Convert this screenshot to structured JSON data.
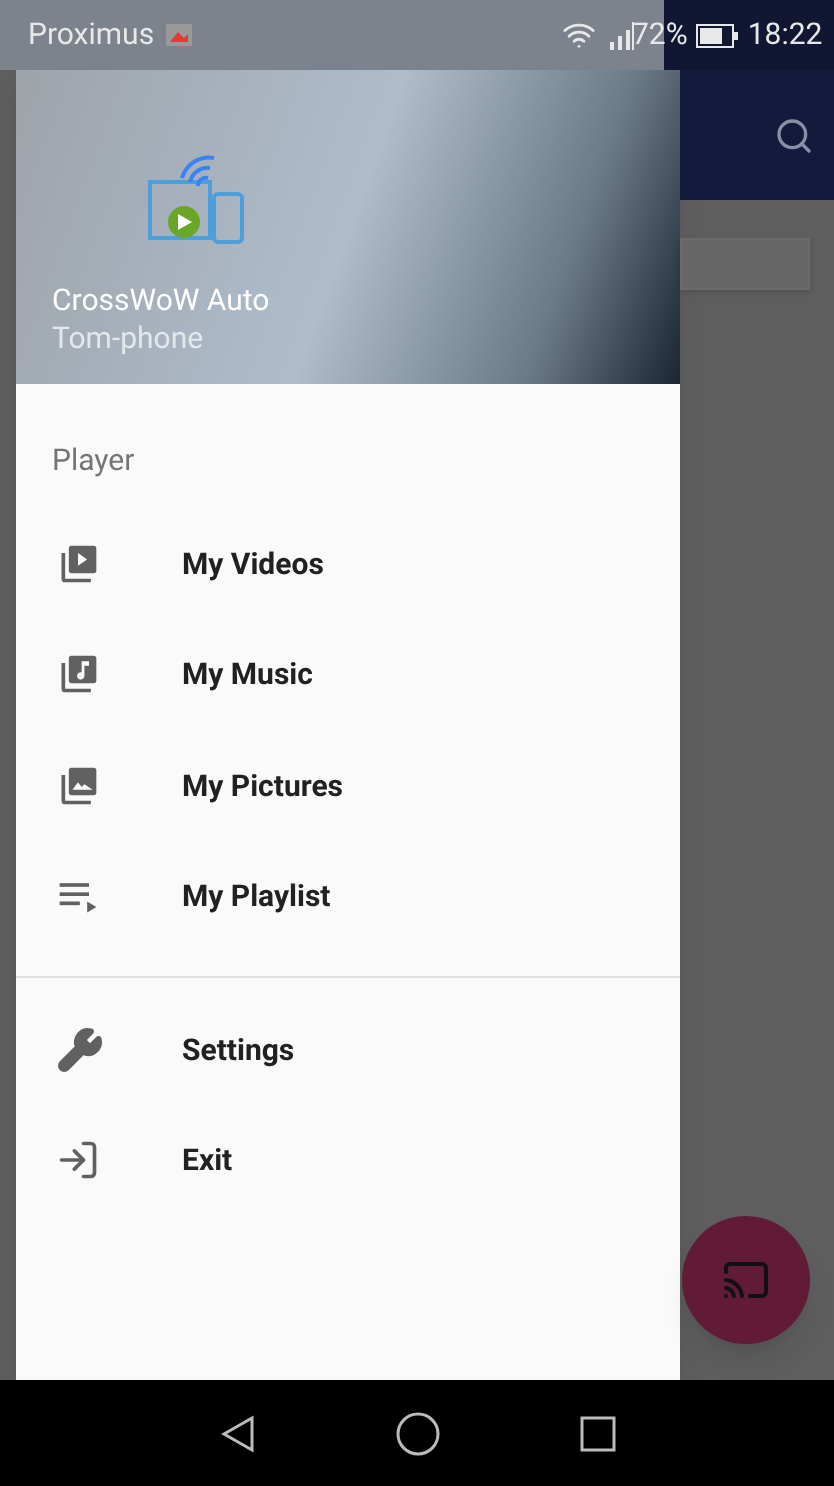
{
  "status_bar": {
    "carrier": "Proximus",
    "battery": "72%",
    "time": "18:22"
  },
  "drawer": {
    "header": {
      "app_name": "CrossWoW Auto",
      "device": "Tom-phone"
    },
    "groups": [
      {
        "title": "Player",
        "items": [
          {
            "label": "My Videos"
          },
          {
            "label": "My Music"
          },
          {
            "label": "My Pictures"
          },
          {
            "label": "My Playlist"
          }
        ]
      },
      {
        "items": [
          {
            "label": "Settings"
          },
          {
            "label": "Exit"
          }
        ]
      }
    ]
  }
}
